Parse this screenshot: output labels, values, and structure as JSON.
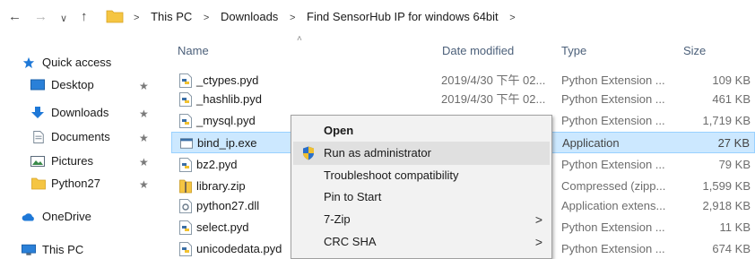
{
  "toolbar": {
    "back_glyph": "←",
    "forward_glyph": "→",
    "recent_glyph": "∨",
    "up_glyph": "↑"
  },
  "breadcrumb": {
    "separator": ">",
    "items": [
      "This PC",
      "Downloads",
      "Find SensorHub IP for windows 64bit"
    ]
  },
  "columns": {
    "name": "Name",
    "date": "Date modified",
    "type": "Type",
    "size": "Size",
    "sort_glyph": "˄"
  },
  "sidebar": {
    "pin_glyph": "★",
    "items": [
      {
        "label": "Quick access",
        "icon": "star-icon"
      },
      {
        "label": "Desktop",
        "icon": "desktop-icon",
        "pinned": true
      },
      {
        "label": "Downloads",
        "icon": "downloads-icon",
        "pinned": true
      },
      {
        "label": "Documents",
        "icon": "documents-icon",
        "pinned": true
      },
      {
        "label": "Pictures",
        "icon": "pictures-icon",
        "pinned": true
      },
      {
        "label": "Python27",
        "icon": "folder-icon",
        "pinned": true
      },
      {
        "label": "OneDrive",
        "icon": "onedrive-icon"
      },
      {
        "label": "This PC",
        "icon": "this-pc-icon"
      }
    ]
  },
  "files": [
    {
      "name": "_ctypes.pyd",
      "date": "2019/4/30 下午 02...",
      "type": "Python Extension ...",
      "size": "109 KB",
      "icon": "python-file-icon"
    },
    {
      "name": "_hashlib.pyd",
      "date": "2019/4/30 下午 02...",
      "type": "Python Extension ...",
      "size": "461 KB",
      "icon": "python-file-icon"
    },
    {
      "name": "_mysql.pyd",
      "date": "",
      "type": "Python Extension ...",
      "size": "1,719 KB",
      "icon": "python-file-icon"
    },
    {
      "name": "bind_ip.exe",
      "date": "",
      "type": "Application",
      "size": "27 KB",
      "icon": "exe-file-icon",
      "selected": true
    },
    {
      "name": "bz2.pyd",
      "date": "",
      "type": "Python Extension ...",
      "size": "79 KB",
      "icon": "python-file-icon"
    },
    {
      "name": "library.zip",
      "date": "",
      "type": "Compressed (zipp...",
      "size": "1,599 KB",
      "icon": "zip-file-icon"
    },
    {
      "name": "python27.dll",
      "date": "",
      "type": "Application extens...",
      "size": "2,918 KB",
      "icon": "dll-file-icon"
    },
    {
      "name": "select.pyd",
      "date": "",
      "type": "Python Extension ...",
      "size": "11 KB",
      "icon": "python-file-icon"
    },
    {
      "name": "unicodedata.pyd",
      "date": "",
      "type": "Python Extension ...",
      "size": "674 KB",
      "icon": "python-file-icon"
    }
  ],
  "context_menu": {
    "submenu_glyph": ">",
    "items": [
      {
        "label": "Open",
        "bold": true
      },
      {
        "label": "Run as administrator",
        "icon": "uac-shield-icon",
        "highlighted": true
      },
      {
        "label": "Troubleshoot compatibility"
      },
      {
        "label": "Pin to Start"
      },
      {
        "label": "7-Zip",
        "submenu": true
      },
      {
        "label": "CRC SHA",
        "submenu": true
      }
    ]
  },
  "colors": {
    "selection_bg": "#cce8ff",
    "selection_border": "#99d1ff",
    "header_text": "#4c607a",
    "folder_yellow": "#f5c542",
    "accent_blue": "#1e78d7"
  }
}
